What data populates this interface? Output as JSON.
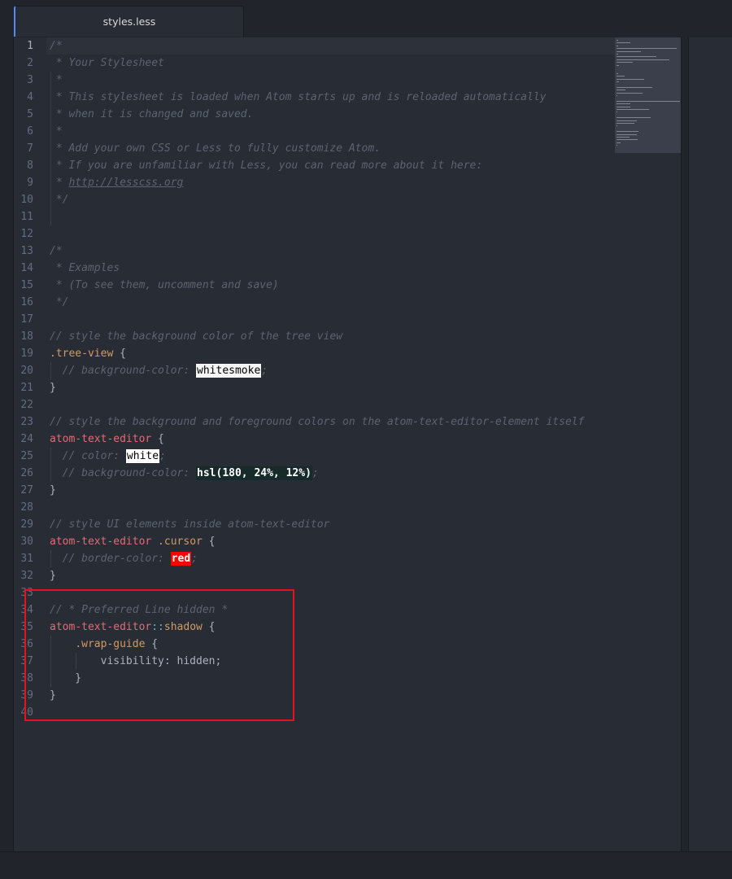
{
  "tab": {
    "title": "styles.less"
  },
  "lines": [
    [
      {
        "t": "/*",
        "c": "cm"
      }
    ],
    [
      {
        "t": " * Your Stylesheet",
        "c": "cm"
      }
    ],
    [
      {
        "t": " *",
        "c": "cm"
      }
    ],
    [
      {
        "t": " * This stylesheet is loaded when Atom starts up and is reloaded automatically",
        "c": "cm"
      }
    ],
    [
      {
        "t": " * when it is changed and saved.",
        "c": "cm"
      }
    ],
    [
      {
        "t": " *",
        "c": "cm"
      }
    ],
    [
      {
        "t": " * Add your own CSS or Less to fully customize Atom.",
        "c": "cm"
      }
    ],
    [
      {
        "t": " * If you are unfamiliar with Less, you can read more about it here:",
        "c": "cm"
      }
    ],
    [
      {
        "t": " * ",
        "c": "cm"
      },
      {
        "t": "http://lesscss.org",
        "c": "url"
      }
    ],
    [
      {
        "t": " */",
        "c": "cm"
      }
    ],
    [],
    [],
    [
      {
        "t": "/*",
        "c": "cm"
      }
    ],
    [
      {
        "t": " * Examples",
        "c": "cm"
      }
    ],
    [
      {
        "t": " * (To see them, uncomment and save)",
        "c": "cm"
      }
    ],
    [
      {
        "t": " */",
        "c": "cm"
      }
    ],
    [],
    [
      {
        "t": "// style the background color of the tree view",
        "c": "cm"
      }
    ],
    [
      {
        "t": ".tree-view",
        "c": "cls"
      },
      {
        "t": " {",
        "c": "pu"
      }
    ],
    [
      {
        "t": "  // background-color: ",
        "c": "cm"
      },
      {
        "t": "whitesmoke",
        "c": "sw sw-ws"
      },
      {
        "t": ";",
        "c": "cm"
      }
    ],
    [
      {
        "t": "}",
        "c": "pu"
      }
    ],
    [],
    [
      {
        "t": "// style the background and foreground colors on the atom-text-editor-element itself",
        "c": "cm"
      }
    ],
    [
      {
        "t": "atom-text-editor",
        "c": "sel"
      },
      {
        "t": " {",
        "c": "pu"
      }
    ],
    [
      {
        "t": "  // color: ",
        "c": "cm"
      },
      {
        "t": "white",
        "c": "sw sw-white"
      },
      {
        "t": ";",
        "c": "cm"
      }
    ],
    [
      {
        "t": "  // background-color: ",
        "c": "cm"
      },
      {
        "t": "hsl(180, 24%, 12%)",
        "c": "sw sw-hsl"
      },
      {
        "t": ";",
        "c": "cm"
      }
    ],
    [
      {
        "t": "}",
        "c": "pu"
      }
    ],
    [],
    [
      {
        "t": "// style UI elements inside atom-text-editor",
        "c": "cm"
      }
    ],
    [
      {
        "t": "atom-text-editor",
        "c": "sel"
      },
      {
        "t": " .cursor",
        "c": "cls"
      },
      {
        "t": " {",
        "c": "pu"
      }
    ],
    [
      {
        "t": "  // border-color: ",
        "c": "cm"
      },
      {
        "t": "red",
        "c": "sw sw-red"
      },
      {
        "t": ";",
        "c": "cm"
      }
    ],
    [
      {
        "t": "}",
        "c": "pu"
      }
    ],
    [],
    [
      {
        "t": "// * Preferred Line hidden *",
        "c": "cm"
      }
    ],
    [
      {
        "t": "atom-text-editor",
        "c": "sel"
      },
      {
        "t": "::",
        "c": "ps"
      },
      {
        "t": "shadow",
        "c": "cls"
      },
      {
        "t": " {",
        "c": "pu"
      }
    ],
    [
      {
        "t": "    ",
        "c": "pl"
      },
      {
        "t": ".wrap-guide",
        "c": "cls"
      },
      {
        "t": " {",
        "c": "pu"
      }
    ],
    [
      {
        "t": "        visibility: hidden;",
        "c": "pl"
      }
    ],
    [
      {
        "t": "    }",
        "c": "pu"
      }
    ],
    [
      {
        "t": "}",
        "c": "pu"
      }
    ],
    []
  ],
  "cursor_line": 1,
  "colors": {
    "accent": "#568af2",
    "highlight_box": "#e3141b",
    "editor_bg": "#282c34"
  }
}
